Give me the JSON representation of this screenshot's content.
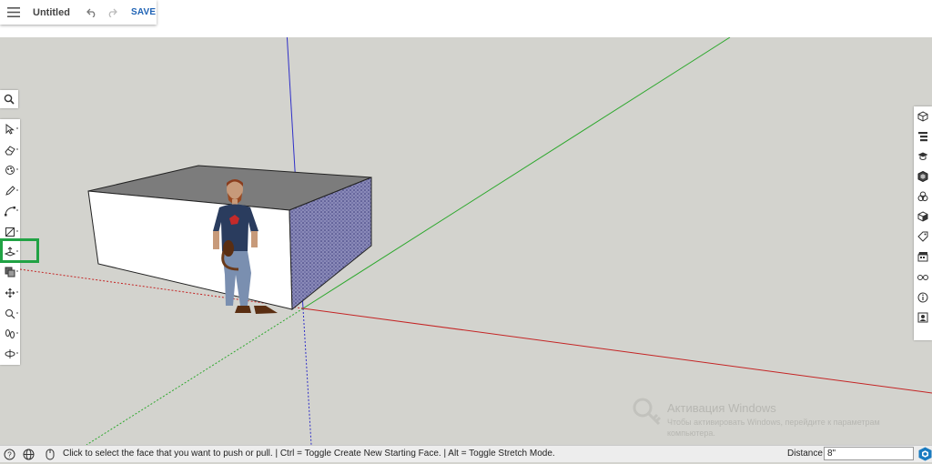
{
  "app": {
    "title": "Untitled",
    "save_label": "SAVE"
  },
  "icons": {
    "menu": "hamburger-menu-icon",
    "undo": "undo-icon",
    "redo": "redo-icon"
  },
  "left_tools": [
    {
      "name": "select-tool",
      "icon": "arrow-cursor-icon"
    },
    {
      "name": "eraser-tool",
      "icon": "eraser-icon"
    },
    {
      "name": "tag-paint-tool",
      "icon": "paint-brush-icon"
    },
    {
      "name": "line-tool",
      "icon": "pencil-icon"
    },
    {
      "name": "arc-tool",
      "icon": "arc-icon"
    },
    {
      "name": "rectangle-tool",
      "icon": "rectangle-icon"
    },
    {
      "name": "push-pull-tool",
      "icon": "push-pull-icon"
    },
    {
      "name": "offset-tool",
      "icon": "offset-icon"
    },
    {
      "name": "move-tool",
      "icon": "move-arrows-icon"
    },
    {
      "name": "tape-measure-tool",
      "icon": "tape-measure-icon"
    },
    {
      "name": "walk-tool",
      "icon": "footprints-icon"
    },
    {
      "name": "orbit-tool",
      "icon": "orbit-icon"
    }
  ],
  "right_panels": [
    "entity-info-icon",
    "outliner-icon",
    "instructor-icon",
    "components-icon",
    "materials-icon",
    "styles-icon",
    "tags-icon",
    "scenes-icon",
    "display-icon",
    "info-icon",
    "account-icon"
  ],
  "watermark": {
    "title": "Активация Windows",
    "subtitle": "Чтобы активировать Windows, перейдите к параметрам компьютера."
  },
  "status_bar": {
    "message": "Click to select the face that you want to push or pull. | Ctrl = Toggle Create New Starting Face. | Alt = Toggle Stretch Mode.",
    "distance_label": "Distance",
    "distance_value": "8\""
  },
  "colors": {
    "red_axis": "#d02a2a",
    "green_axis": "#2ea82e",
    "blue_axis": "#3030c8",
    "highlight": "#21a244",
    "save": "#1f63b5"
  }
}
